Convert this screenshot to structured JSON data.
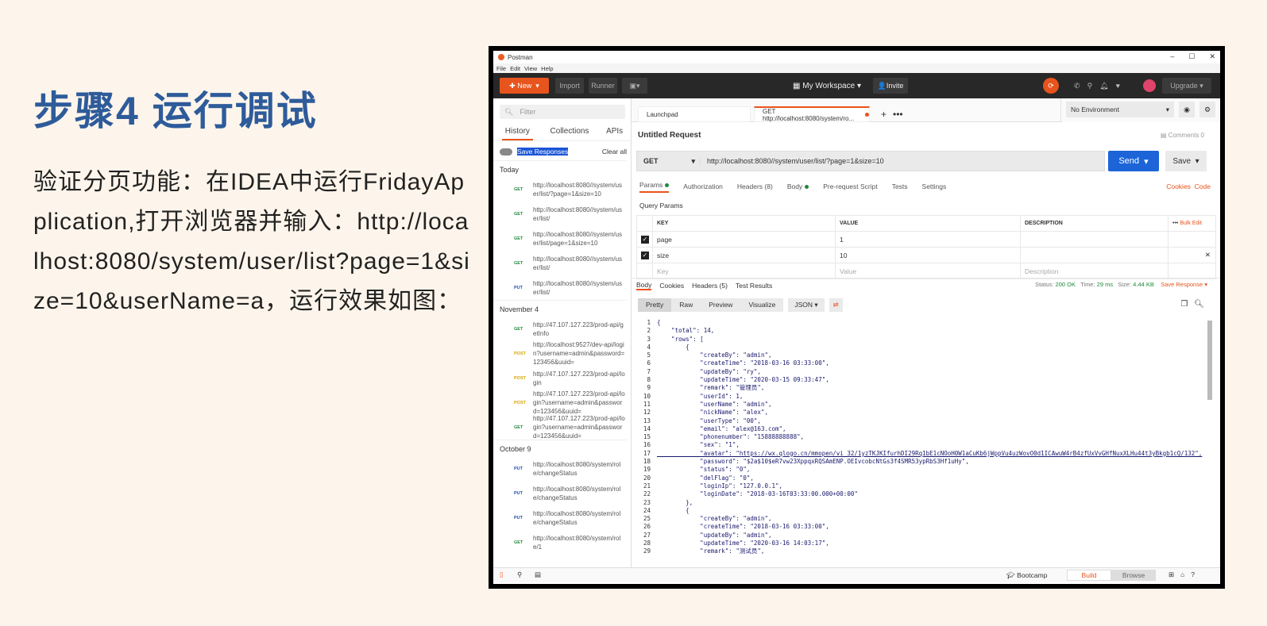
{
  "slide": {
    "title": "步骤4 运行调试",
    "description": "验证分页功能：在IDEA中运行FridayApplication,打开浏览器并输入：http://localhost:8080/system/user/list?page=1&size=10&userName=a，运行效果如图："
  },
  "window": {
    "title": "Postman",
    "menu": [
      "File",
      "Edit",
      "View",
      "Help"
    ]
  },
  "toolbar": {
    "new": "New",
    "import": "Import",
    "runner": "Runner",
    "workspace": "My Workspace",
    "invite": "Invite",
    "upgrade": "Upgrade"
  },
  "sidebar": {
    "filter_placeholder": "Filter",
    "tabs": [
      "History",
      "Collections",
      "APIs"
    ],
    "save_responses": "Save Responses",
    "clear_all": "Clear all",
    "groups": [
      {
        "label": "Today",
        "items": [
          {
            "method": "GET",
            "url": "http://localhost:8080//system/user/list/?page=1&size=10"
          },
          {
            "method": "GET",
            "url": "http://localhost:8080//system/user/list/"
          },
          {
            "method": "GET",
            "url": "http://localhost:8080//system/user/list/page=1&size=10"
          },
          {
            "method": "GET",
            "url": "http://localhost:8080//system/user/list/"
          },
          {
            "method": "PUT",
            "url": "http://localhost:8080//system/user/list/"
          }
        ]
      },
      {
        "label": "November 4",
        "items": [
          {
            "method": "GET",
            "url": "http://47.107.127.223/prod-api/getInfo"
          },
          {
            "method": "POST",
            "url": "http://localhost:9527/dev-api/login?username=admin&password=123456&uuid="
          },
          {
            "method": "POST",
            "url": "http://47.107.127.223/prod-api/login"
          },
          {
            "method": "POST",
            "url": "http://47.107.127.223/prod-api/login?username=admin&password=123456&uuid="
          },
          {
            "method": "GET",
            "url": "http://47.107.127.223/prod-api/login?username=admin&password=123456&uuid="
          }
        ]
      },
      {
        "label": "October 9",
        "items": [
          {
            "method": "PUT",
            "url": "http://localhost:8080/system/role/changeStatus"
          },
          {
            "method": "PUT",
            "url": "http://localhost:8080/system/role/changeStatus"
          },
          {
            "method": "PUT",
            "url": "http://localhost:8080/system/role/changeStatus"
          },
          {
            "method": "GET",
            "url": "http://localhost:8080/system/role/1"
          }
        ]
      }
    ]
  },
  "tabs": {
    "launchpad": "Launchpad",
    "active": "GET http://localhost:8080/system/ro...",
    "environment": "No Environment"
  },
  "request": {
    "name": "Untitled Request",
    "comments": "Comments 0",
    "method": "GET",
    "url": "http://localhost:8080//system/user/list/?page=1&size=10",
    "send": "Send",
    "save": "Save",
    "tabs": [
      "Params",
      "Authorization",
      "Headers (8)",
      "Body",
      "Pre-request Script",
      "Tests",
      "Settings"
    ],
    "cookies": "Cookies",
    "code": "Code",
    "query_params": "Query Params",
    "columns": [
      "KEY",
      "VALUE",
      "DESCRIPTION"
    ],
    "bulk_edit": "Bulk Edit",
    "params": [
      {
        "key": "page",
        "value": "1"
      },
      {
        "key": "size",
        "value": "10"
      }
    ],
    "placeholders": {
      "key": "Key",
      "value": "Value",
      "description": "Description"
    }
  },
  "response": {
    "tabs": [
      "Body",
      "Cookies",
      "Headers (5)",
      "Test Results"
    ],
    "status": "200 OK",
    "time": "29 ms",
    "size": "4.44 KB",
    "status_label": "Status:",
    "time_label": "Time:",
    "size_label": "Size:",
    "save_response": "Save Response",
    "views": [
      "Pretty",
      "Raw",
      "Preview",
      "Visualize"
    ],
    "format": "JSON",
    "lines": [
      "{",
      "    \"total\": 14,",
      "    \"rows\": [",
      "        {",
      "            \"createBy\": \"admin\",",
      "            \"createTime\": \"2018-03-16 03:33:00\",",
      "            \"updateBy\": \"ry\",",
      "            \"updateTime\": \"2020-03-15 09:33:47\",",
      "            \"remark\": \"管理员\",",
      "            \"userId\": 1,",
      "            \"userName\": \"admin\",",
      "            \"nickName\": \"alex\",",
      "            \"userType\": \"00\",",
      "            \"email\": \"alex@163.com\",",
      "            \"phonenumber\": \"15888888888\",",
      "            \"sex\": \"1\",",
      "            \"avatar\": \"https://wx.qlogo.cn/mmopen/vi_32/1yzTKJKIfurhDI29Rq1bE1cNOoH0W1aCuKb6jWppVu4uzWovO0d1ICAwuW4rB4zfUxVvGHfNuxXLHu44t3yBkgb1cQ/132\",",
      "            \"password\": \"$2a$10$eR7vw23XppqxRQSAmENP.OEIvcobcNtGs3f4SMR53ypRbS3Hf1uHy\",",
      "            \"status\": \"0\",",
      "            \"delFlag\": \"0\",",
      "            \"loginIp\": \"127.0.0.1\",",
      "            \"loginDate\": \"2018-03-16T03:33:00.000+00:00\"",
      "        },",
      "        {",
      "            \"createBy\": \"admin\",",
      "            \"createTime\": \"2018-03-16 03:33:00\",",
      "            \"updateBy\": \"admin\",",
      "            \"updateTime\": \"2020-03-16 14:03:17\",",
      "            \"remark\": \"测试员\","
    ]
  },
  "bottom": {
    "bootcamp": "Bootcamp",
    "build": "Build",
    "browse": "Browse"
  },
  "colors": {
    "accent": "#e8541d",
    "send": "#1c64d8",
    "title": "#2e5b9a"
  }
}
